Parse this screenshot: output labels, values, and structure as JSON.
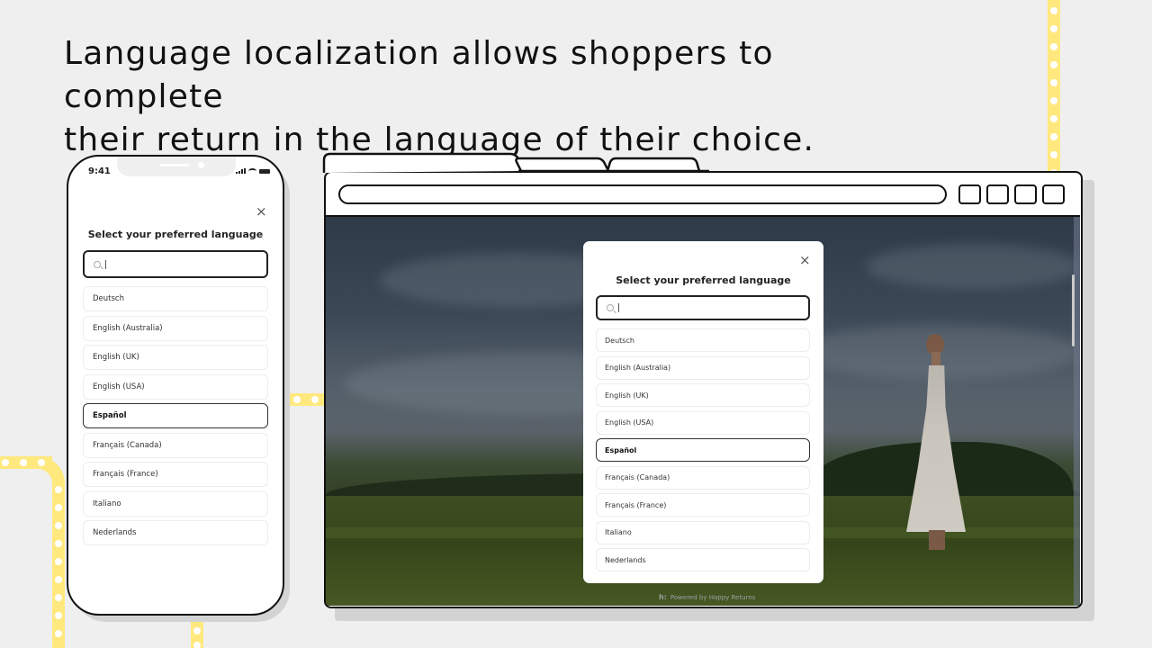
{
  "headline": {
    "line1": "Language localization allows shoppers to complete",
    "line2": "their return in the language of their choice."
  },
  "colors": {
    "background": "#efefef",
    "track_yellow": "#ffe97f",
    "outline": "#111111",
    "selected_border": "#333333"
  },
  "phone": {
    "status_time": "9:41",
    "status_icons": [
      "signal-icon",
      "wifi-icon",
      "battery-icon"
    ],
    "modal": {
      "close_icon": "×",
      "title": "Select your preferred language",
      "search": {
        "value": "",
        "placeholder": ""
      },
      "languages": [
        {
          "label": "Deutsch",
          "selected": false
        },
        {
          "label": "English (Australia)",
          "selected": false
        },
        {
          "label": "English (UK)",
          "selected": false
        },
        {
          "label": "English (USA)",
          "selected": false
        },
        {
          "label": "Español",
          "selected": true
        },
        {
          "label": "Français (Canada)",
          "selected": false
        },
        {
          "label": "Français (France)",
          "selected": false
        },
        {
          "label": "Italiano",
          "selected": false
        },
        {
          "label": "Nederlands",
          "selected": false
        }
      ]
    }
  },
  "browser": {
    "tab_count": 3,
    "window_button_count": 4,
    "modal": {
      "close_icon": "×",
      "title": "Select your preferred language",
      "search": {
        "value": "",
        "placeholder": ""
      },
      "languages": [
        {
          "label": "Deutsch",
          "selected": false
        },
        {
          "label": "English (Australia)",
          "selected": false
        },
        {
          "label": "English (UK)",
          "selected": false
        },
        {
          "label": "English (USA)",
          "selected": false
        },
        {
          "label": "Español",
          "selected": true
        },
        {
          "label": "Français (Canada)",
          "selected": false
        },
        {
          "label": "Français (France)",
          "selected": false
        },
        {
          "label": "Italiano",
          "selected": false
        },
        {
          "label": "Nederlands",
          "selected": false
        }
      ]
    },
    "footer": {
      "logo_icon": "h:",
      "powered_by": "Powered by Happy Returns"
    }
  }
}
